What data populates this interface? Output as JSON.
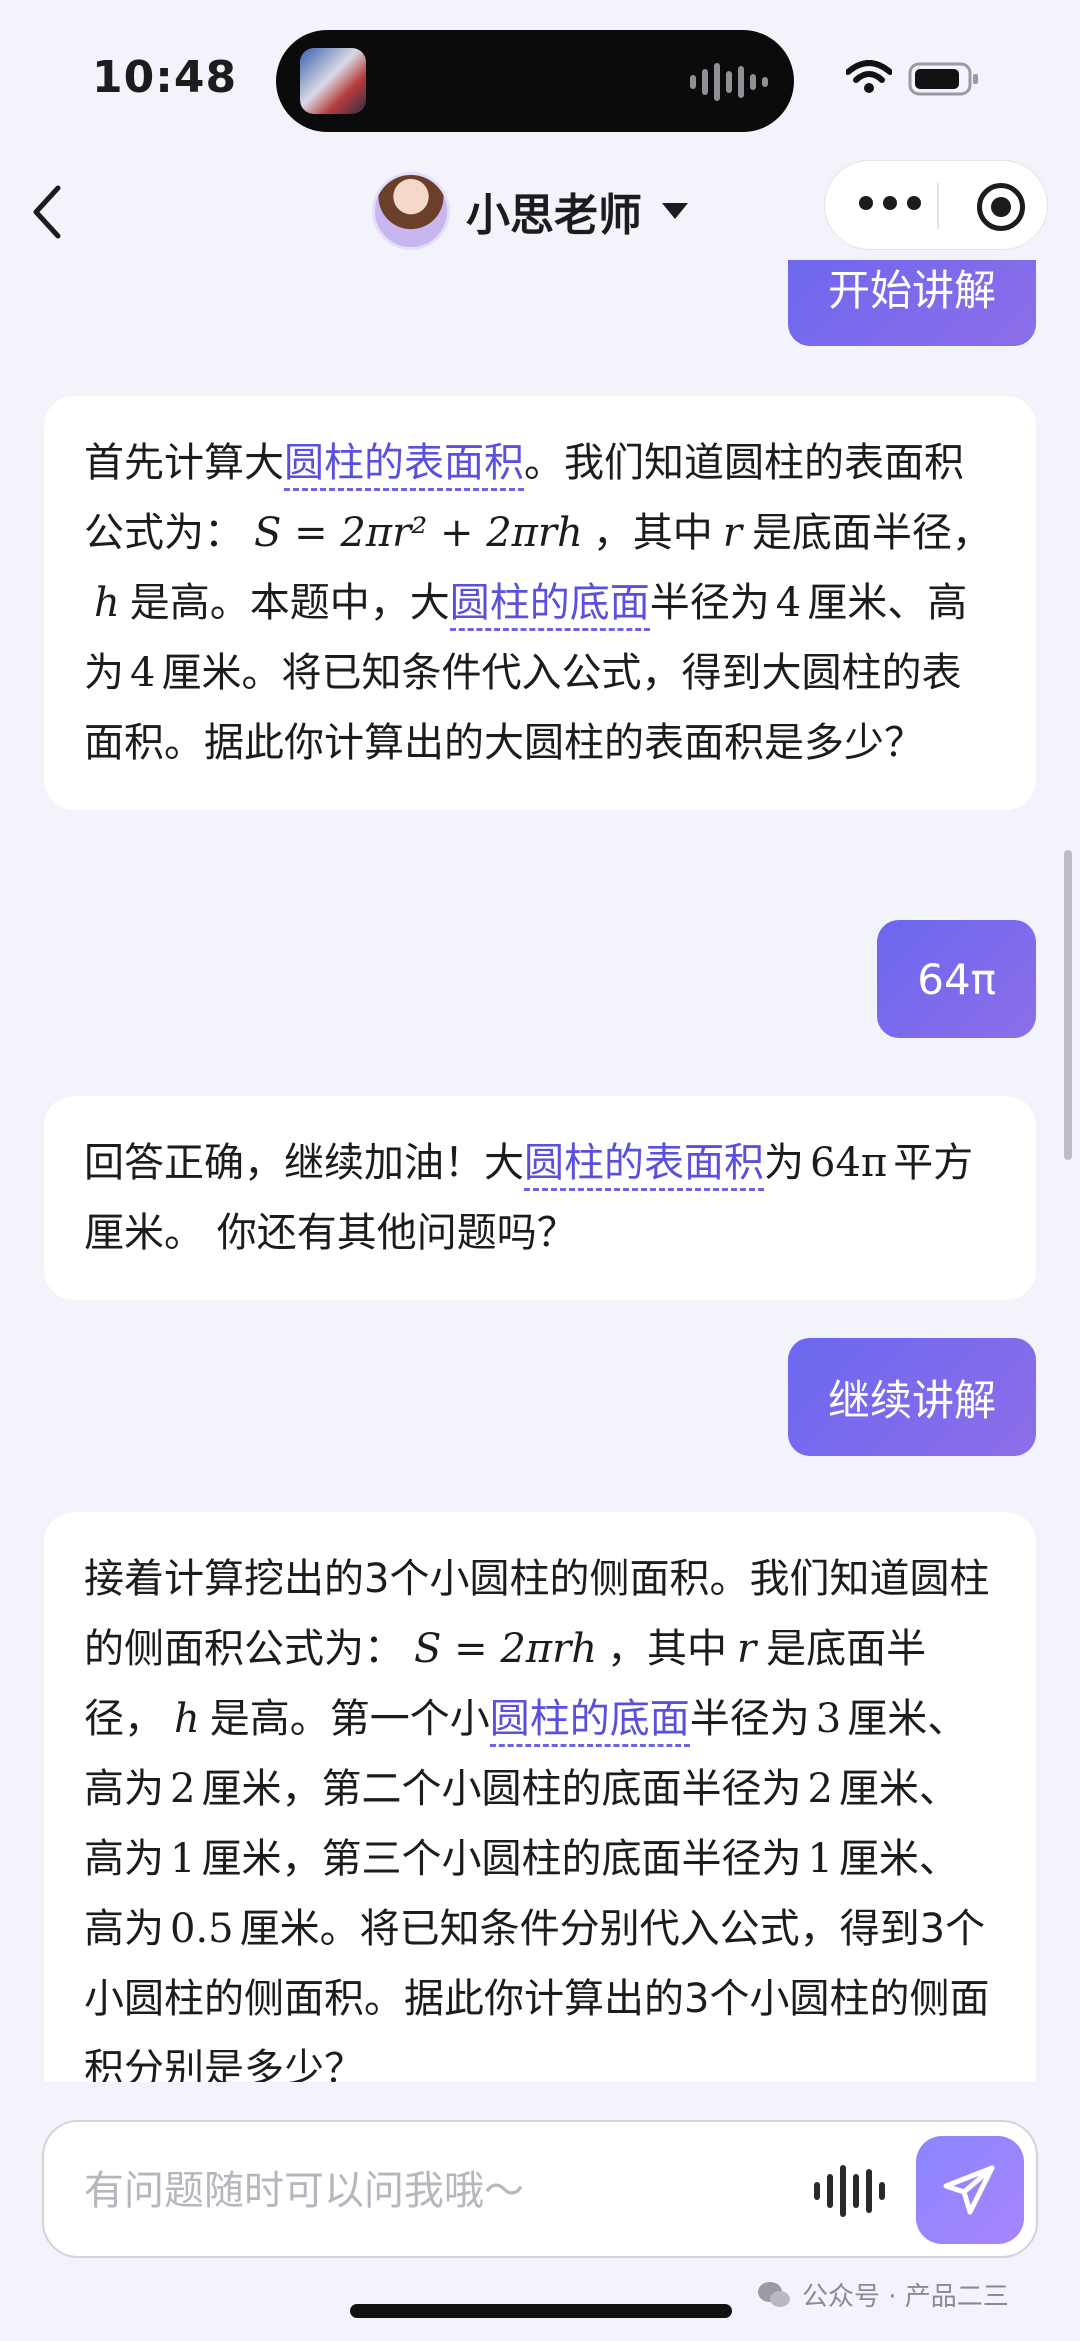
{
  "status_bar": {
    "time": "10:48"
  },
  "nav": {
    "title": "小思老师"
  },
  "messages": {
    "m1": {
      "text": "开始讲解"
    },
    "m2": {
      "t1": "首先计算大",
      "k1": "圆柱的表面积",
      "t2": "。我们知道圆柱的表面积公式为：",
      "formula": "S = 2πr² + 2πrh",
      "t3": "，其中",
      "var_r": "r",
      "t4": "是底面半径，",
      "var_h": "h",
      "t5": "是高。本题中，大",
      "k2": "圆柱的底面",
      "t6": "半径为",
      "n1": "4",
      "t7": "厘米、高为",
      "n2": "4",
      "t8": "厘米。将已知条件代入公式，得到大圆柱的表面积。据此你计算出的大圆柱的表面积是多少？"
    },
    "m3": {
      "text": "64π"
    },
    "m4": {
      "t1": "回答正确，继续加油！大",
      "k1": "圆柱的表面积",
      "t2": "为",
      "value": "64π",
      "t3": "平方厘米。 你还有其他问题吗？"
    },
    "m5": {
      "text": "继续讲解"
    },
    "m6": {
      "t1": "接着计算挖出的3个小圆柱的侧面积。我们知道圆柱的侧面积公式为：",
      "formula": "S = 2πrh",
      "t2": "，其中",
      "var_r": "r",
      "t3": "是底面半径，",
      "var_h": "h",
      "t4": "是高。第一个小",
      "k1": "圆柱的底面",
      "t5": "半径为",
      "n1": "3",
      "t6": "厘米、高为",
      "n2": "2",
      "t7": "厘米，第二个小圆柱的底面半径为",
      "n3": "2",
      "t8": "厘米、高为",
      "n4": "1",
      "t9": "厘米，第三个小圆柱的底面半径为",
      "n5": "1",
      "t10": "厘米、高为",
      "n6": "0.5",
      "t11": "厘米。将已知条件分别代入公式，得到3个小圆柱的侧面积。据此你计算出的3个小圆柱的侧面积分别是多少？"
    }
  },
  "input": {
    "placeholder": "有问题随时可以问我哦～"
  },
  "watermark": {
    "text": "公众号 · 产品二三"
  },
  "colors": {
    "accent": "#6b67f0",
    "keyword": "#5b50dd",
    "background": "#f3f3fb"
  }
}
